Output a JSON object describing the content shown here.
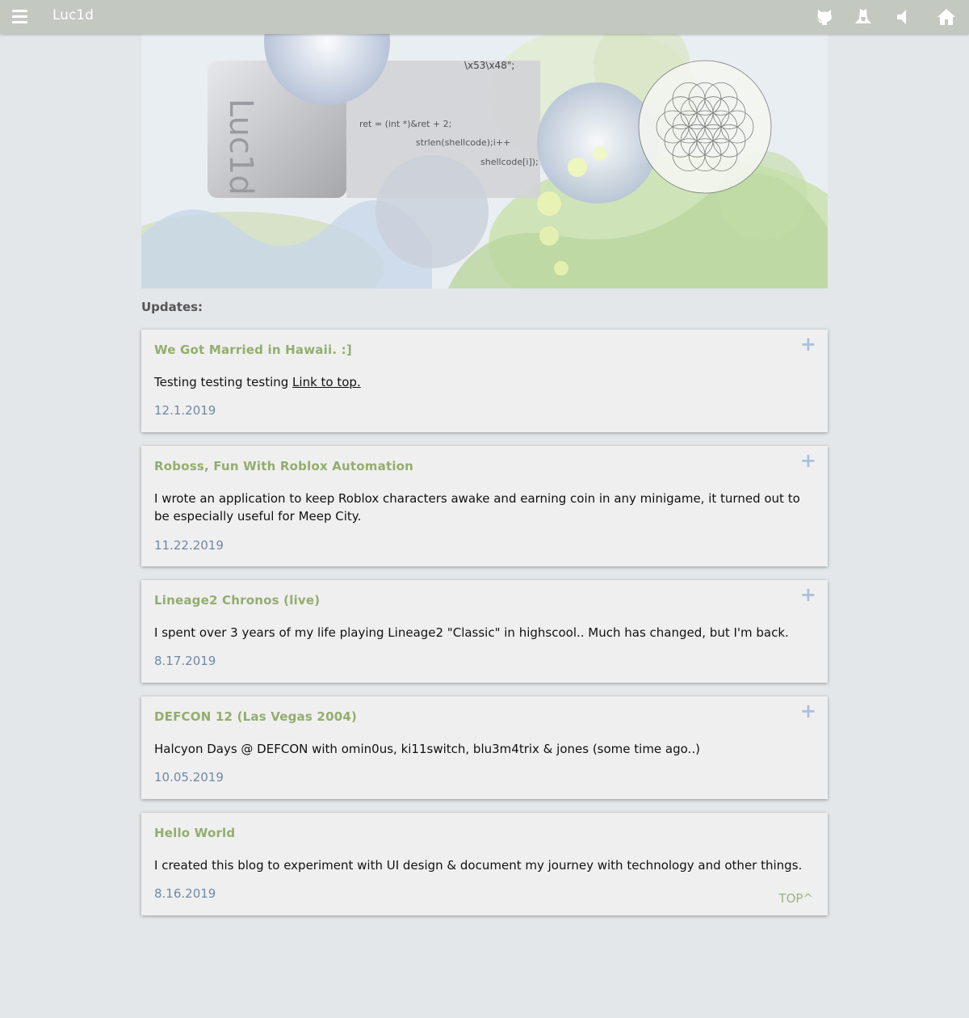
{
  "header": {
    "brand": "Luc1d",
    "icons": [
      "menu-icon",
      "github-icon",
      "hacker-icon",
      "sound-icon",
      "home-icon"
    ],
    "colors": {
      "bar": "#c3c8c1",
      "icon": "#ffffff"
    }
  },
  "banner": {
    "code_lines": [
      "\\x53\\x48\";",
      "ret = (int *)&ret + 2;",
      "strlen(shellcode);i++",
      "shellcode[i]);"
    ],
    "logo_text": "Luc1d"
  },
  "updates_label": "Updates:",
  "posts": [
    {
      "title": "We Got Married in Hawaii. :]",
      "body": "Testing testing testing ",
      "link": "Link to top.",
      "date": "12.1.2019",
      "expand": "+"
    },
    {
      "title": "Roboss, Fun With Roblox Automation",
      "body": "I wrote an application to keep Roblox characters awake and earning coin in any minigame, it turned out to be especially useful for Meep City.",
      "date": "11.22.2019",
      "expand": "+"
    },
    {
      "title": "Lineage2 Chronos (live)",
      "body": "I spent over 3 years of my life playing Lineage2 \"Classic\" in highscool.. Much has changed, but I'm back.",
      "date": "8.17.2019",
      "expand": "+"
    },
    {
      "title": "DEFCON 12 (Las Vegas 2004)",
      "body": "Halcyon Days @ DEFCON with omin0us, ki11switch, blu3m4trix & jones (some time ago..)",
      "date": "10.05.2019",
      "expand": "+"
    },
    {
      "title": "Hello World",
      "body": "I created this blog to experiment with UI design & document my journey with technology and other things.",
      "date": "8.16.2019"
    }
  ],
  "top_link": "TOP^",
  "colors": {
    "title": "#93ad6d",
    "date": "#6f89a4",
    "plus": "#a9c0df",
    "card": "#efefef",
    "background": "#e3e7ea"
  }
}
